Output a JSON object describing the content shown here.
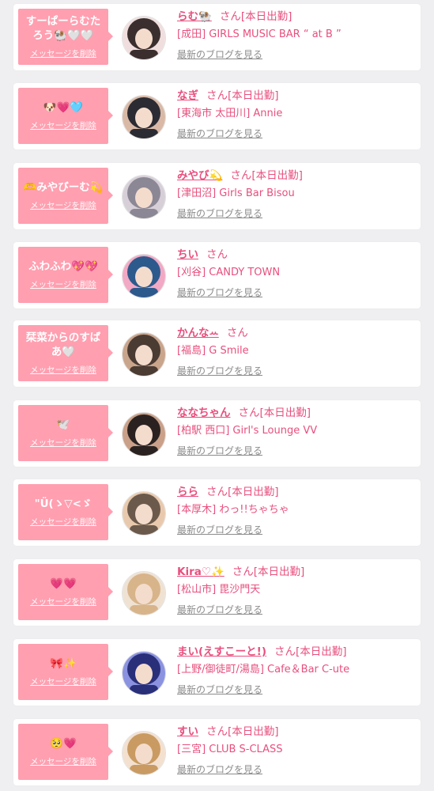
{
  "favorites": [
    {
      "message": "すーぱーらむたろう🐏🤍🤍",
      "delete_label": "メッセージを削除",
      "name": "らむ🐏",
      "suffix": "さん",
      "status": "[本日出勤]",
      "shop": "[成田] GIRLS MUSIC BAR “ at B ”",
      "blog_link": "最新のブログを見る",
      "avatar_colors": [
        "#3a2f2e",
        "#f0dede"
      ]
    },
    {
      "message": "🐶💗🩵",
      "delete_label": "メッセージを削除",
      "name": "なぎ",
      "suffix": "さん",
      "status": "[本日出勤]",
      "shop": "[東海市 太田川] Annie",
      "blog_link": "最新のブログを見る",
      "avatar_colors": [
        "#2b2b33",
        "#d9b9a6"
      ]
    },
    {
      "message": "🫶みやびーむ💫",
      "delete_label": "メッセージを削除",
      "name": "みやび💫",
      "suffix": "さん",
      "status": "[本日出勤]",
      "shop": "[津田沼] Girls Bar Bisou",
      "blog_link": "最新のブログを見る",
      "avatar_colors": [
        "#8c8794",
        "#d6cfd8"
      ]
    },
    {
      "message": "ふわふわ💖💖",
      "delete_label": "メッセージを削除",
      "name": "ちい",
      "suffix": "さん",
      "status": "",
      "shop": "[刈谷] CANDY TOWN",
      "blog_link": "最新のブログを見る",
      "avatar_colors": [
        "#2d5a8c",
        "#f2a9c4"
      ]
    },
    {
      "message": "栞菜からのすばあ🤍",
      "delete_label": "メッセージを削除",
      "name": "かんなꕀ",
      "suffix": "さん",
      "status": "",
      "shop": "[福島] G Smile",
      "blog_link": "最新のブログを見る",
      "avatar_colors": [
        "#4a3b33",
        "#c9a58c"
      ]
    },
    {
      "message": "🕊️",
      "delete_label": "メッセージを削除",
      "name": "ななちゃん",
      "suffix": "さん",
      "status": "[本日出勤]",
      "shop": "[柏駅 西口] Girl's Lounge VV",
      "blog_link": "最新のブログを見る",
      "avatar_colors": [
        "#2a2221",
        "#caa089"
      ]
    },
    {
      "message": "\"Ü(ゝ▽<ゞ",
      "delete_label": "メッセージを削除",
      "name": "らら",
      "suffix": "さん",
      "status": "[本日出勤]",
      "shop": "[本厚木] わっ!!ちゃちゃ",
      "blog_link": "最新のブログを見る",
      "avatar_colors": [
        "#6b5a4c",
        "#e9c9ad"
      ]
    },
    {
      "message": "💗💗",
      "delete_label": "メッセージを削除",
      "name": "Kira♡✨",
      "suffix": "さん",
      "status": "[本日出勤]",
      "shop": "[松山市] 毘沙門天",
      "blog_link": "最新のブログを見る",
      "avatar_colors": [
        "#d8b48a",
        "#efe2d3"
      ]
    },
    {
      "message": "🎀✨",
      "delete_label": "メッセージを削除",
      "name": "まい(えすこーと!)",
      "suffix": "さん",
      "status": "[本日出勤]",
      "shop": "[上野/御徒町/湯島] Cafe＆Bar C-ute",
      "blog_link": "最新のブログを見る",
      "avatar_colors": [
        "#2a2f7a",
        "#8b93e0"
      ]
    },
    {
      "message": "🥺💗",
      "delete_label": "メッセージを削除",
      "name": "すい",
      "suffix": "さん",
      "status": "[本日出勤]",
      "shop": "[三宮] CLUB S-CLASS",
      "blog_link": "最新のブログを見る",
      "avatar_colors": [
        "#c99b62",
        "#f3e0cf"
      ]
    }
  ]
}
